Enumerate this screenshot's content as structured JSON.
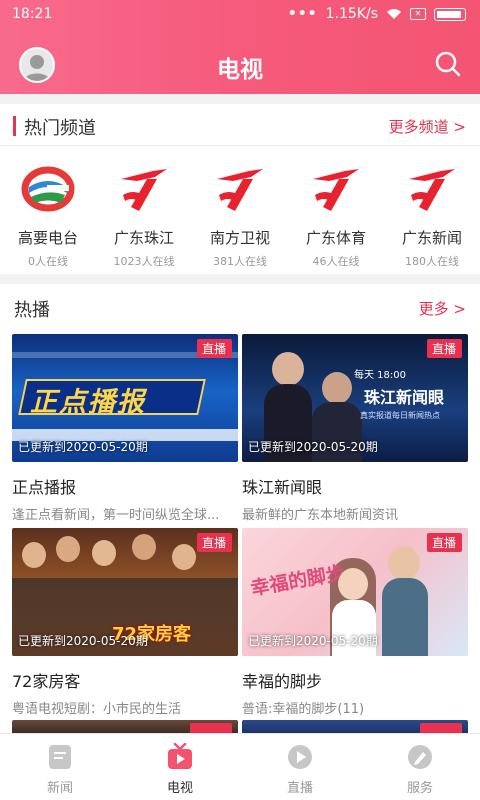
{
  "status": {
    "time": "18:21",
    "speed": "1.15K/s"
  },
  "header": {
    "title": "电视"
  },
  "hot_channels": {
    "title": "热门频道",
    "more": "更多频道 >",
    "items": [
      {
        "name": "高要电台",
        "online": "0人在线",
        "logo": "gaoyao-radio-logo"
      },
      {
        "name": "广东珠江",
        "online": "1023人在线",
        "logo": "gdtv-logo"
      },
      {
        "name": "南方卫视",
        "online": "381人在线",
        "logo": "gdtv-logo"
      },
      {
        "name": "广东体育",
        "online": "46人在线",
        "logo": "gdtv-logo"
      },
      {
        "name": "广东新闻",
        "online": "180人在线",
        "logo": "gdtv-logo"
      }
    ]
  },
  "hot_broadcast": {
    "title": "热播",
    "more": "更多 >",
    "items": [
      {
        "title": "正点播报",
        "desc": "逢正点看新闻，第一时间纵览全球...",
        "badge": "直播",
        "updated": "已更新到2020-05-20期",
        "thumb_text": "正点播报"
      },
      {
        "title": "珠江新闻眼",
        "desc": "最新鲜的广东本地新闻资讯",
        "badge": "直播",
        "updated": "已更新到2020-05-20期",
        "thumb_text": "珠江新闻眼",
        "thumb_sub": "每天 18:00",
        "thumb_sub2": "真实报道每日新闻热点"
      },
      {
        "title": "72家房客",
        "desc": "粤语电视短剧：小市民的生活",
        "badge": "直播",
        "updated": "已更新到2020-05-20期",
        "thumb_text": "72家房客"
      },
      {
        "title": "幸福的脚步",
        "desc": "普语:幸福的脚步(11)",
        "badge": "直播",
        "updated": "已更新到2020-05-20期",
        "thumb_text": "幸福的脚步"
      }
    ]
  },
  "tabs": [
    {
      "label": "新闻",
      "icon": "news-icon",
      "active": false
    },
    {
      "label": "电视",
      "icon": "tv-icon",
      "active": true
    },
    {
      "label": "直播",
      "icon": "live-play-icon",
      "active": false
    },
    {
      "label": "服务",
      "icon": "service-icon",
      "active": false
    }
  ],
  "colors": {
    "header": "#f65a7c",
    "accent": "#e3334e",
    "badge": "#e8314e"
  }
}
